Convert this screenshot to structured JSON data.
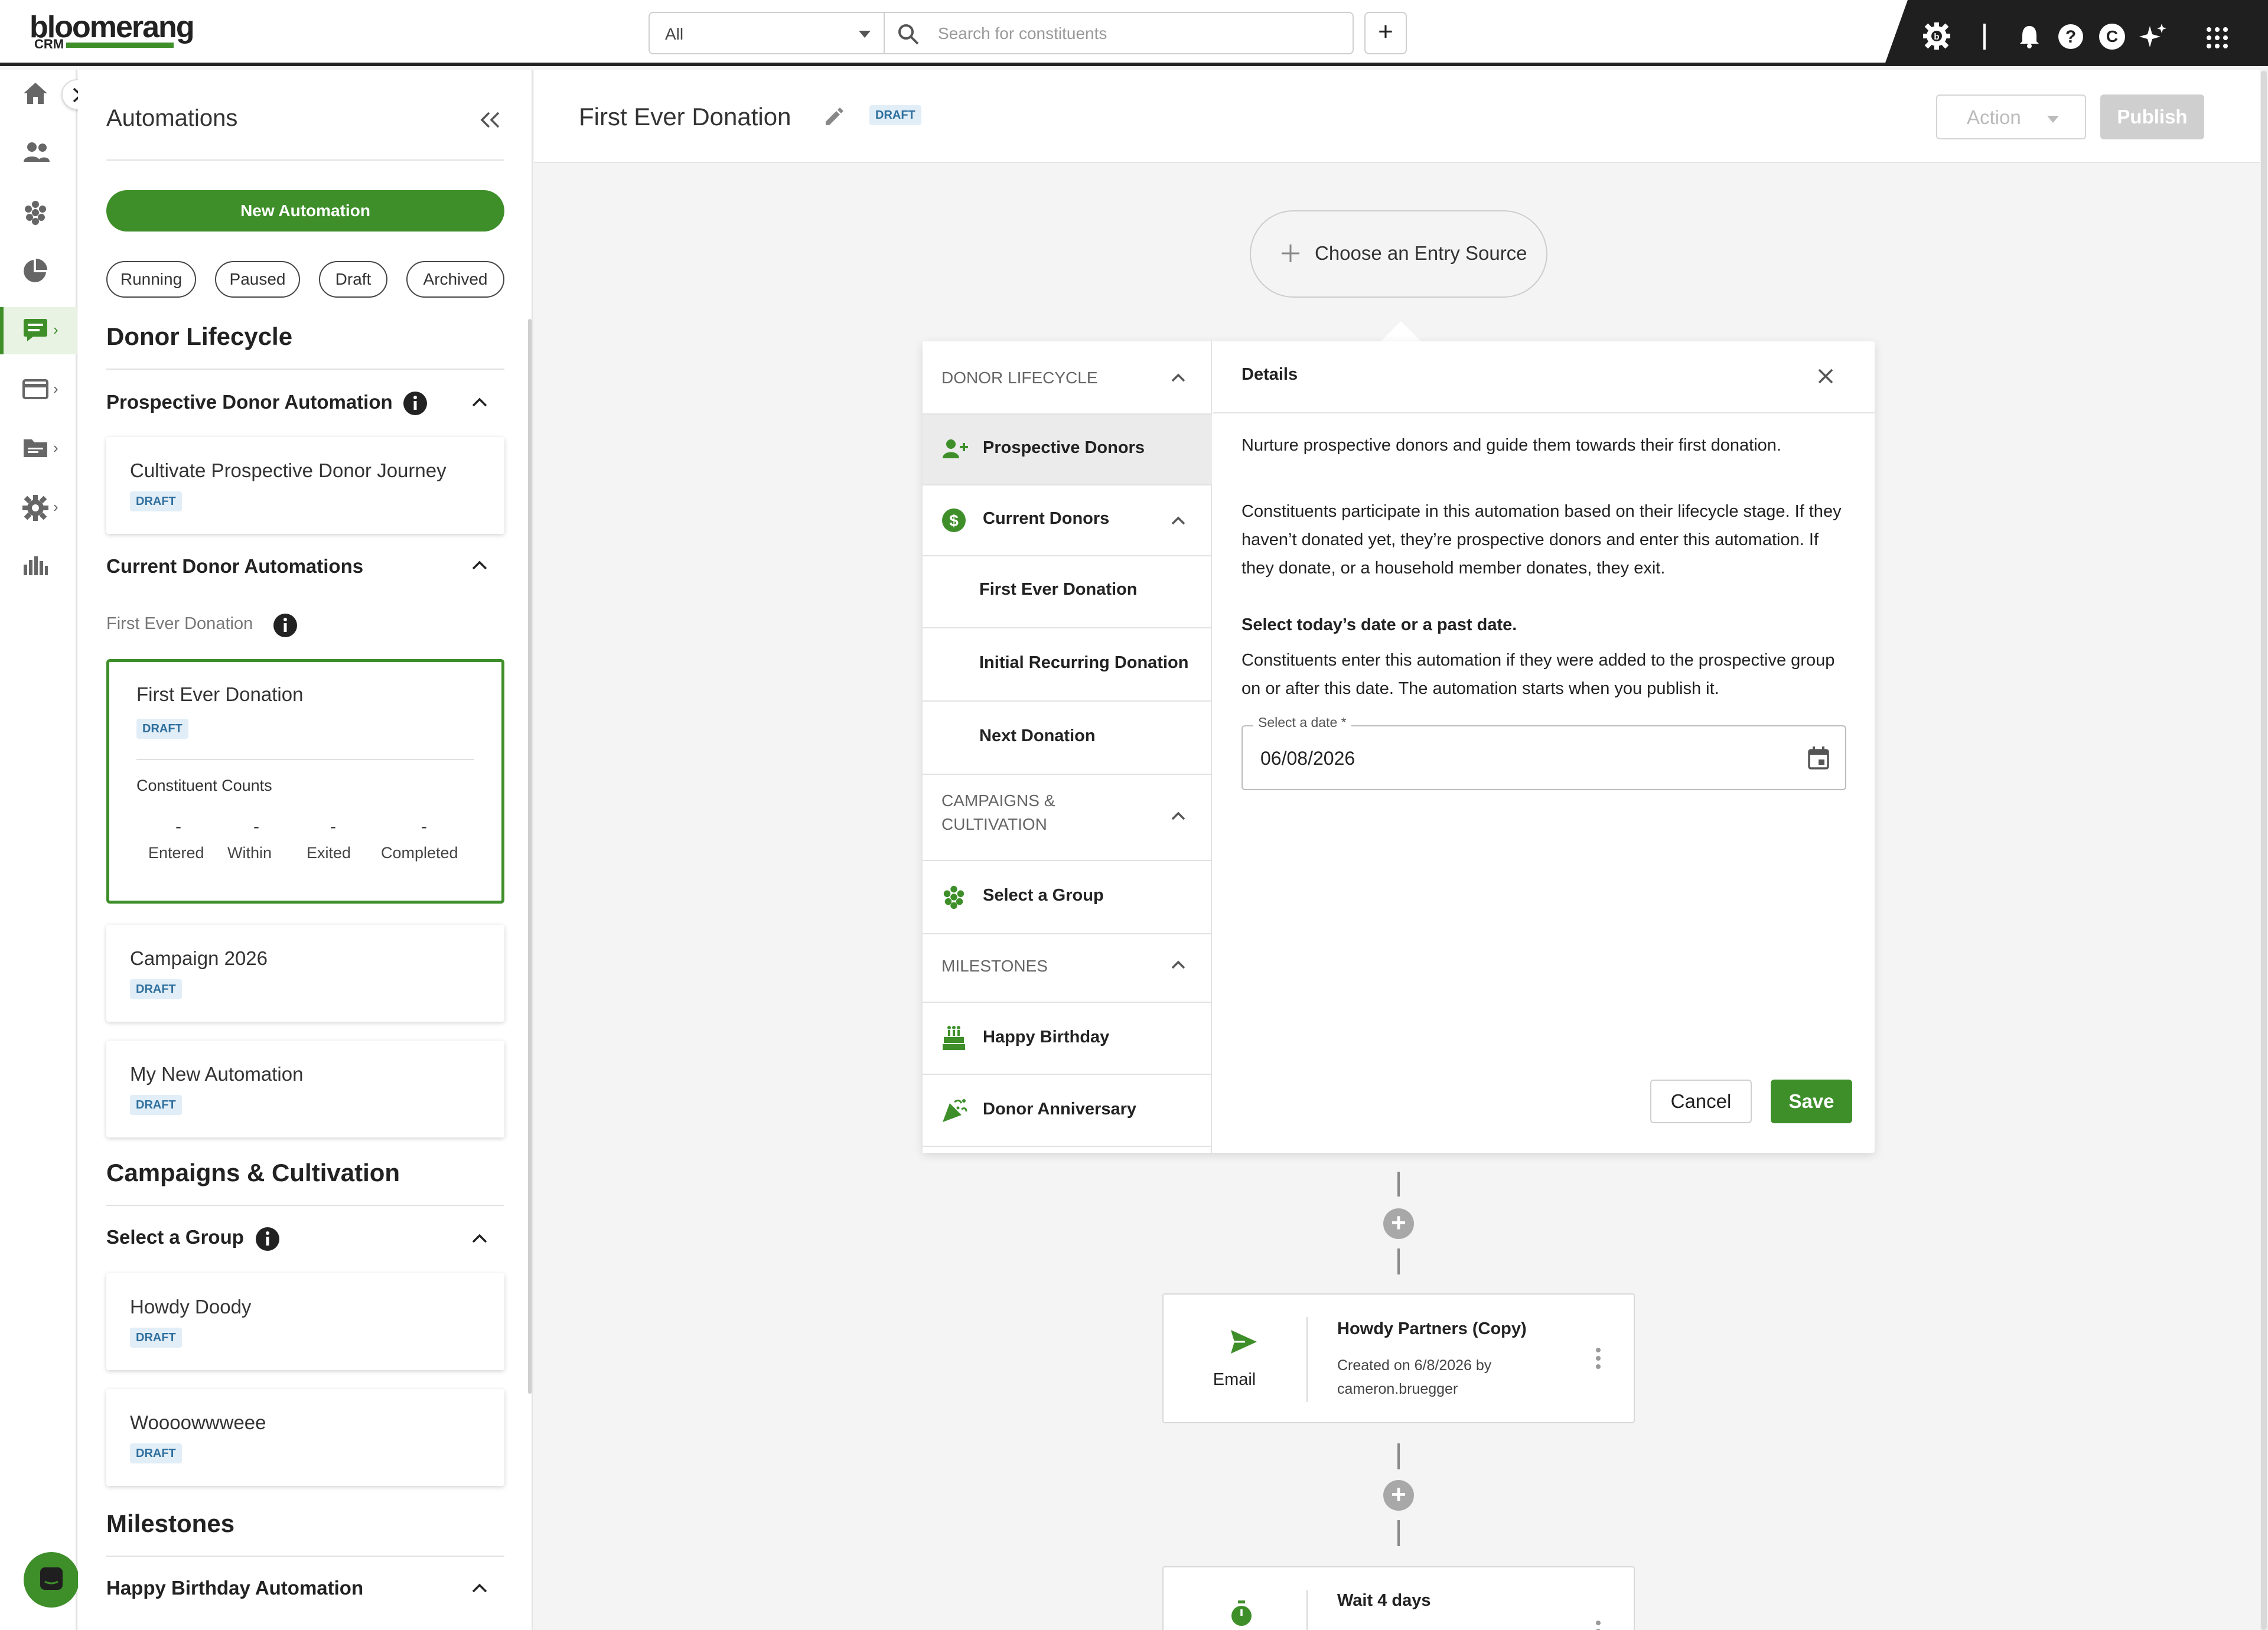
{
  "app": {
    "logo_text": "bloomerang",
    "logo_sub": "CRM",
    "brand_color": "#3e8f2a"
  },
  "topbar": {
    "scope_value": "All",
    "search_placeholder": "Search for constituents",
    "add_label": "+",
    "user_initial": "C",
    "icons": [
      "settings-icon",
      "notification-bell-icon",
      "help-icon",
      "user-avatar",
      "ai-sparkle-icon",
      "app-grid-icon"
    ]
  },
  "rail": {
    "icons": [
      "home-icon",
      "constituents-icon",
      "groups-icon",
      "reports-icon",
      "automations-icon",
      "payments-icon",
      "files-icon",
      "settings-icon",
      "analytics-icon"
    ]
  },
  "list_panel": {
    "title": "Automations",
    "new_button": "New Automation",
    "filters": [
      "Running",
      "Paused",
      "Draft",
      "Archived"
    ],
    "donor_lifecycle": {
      "heading": "Donor Lifecycle",
      "prospective_group": "Prospective Donor Automation",
      "prospective_card": {
        "name": "Cultivate Prospective Donor Journey",
        "status": "DRAFT"
      },
      "current_group": "Current Donor Automations",
      "current_sub": "First Ever Donation",
      "selected_card": {
        "name": "First Ever Donation",
        "status": "DRAFT",
        "counts_label": "Constituent Counts",
        "counts": [
          {
            "value": "-",
            "label": "Entered"
          },
          {
            "value": "-",
            "label": "Within"
          },
          {
            "value": "-",
            "label": "Exited"
          },
          {
            "value": "-",
            "label": "Completed"
          }
        ]
      },
      "other_cards": [
        {
          "name": "Campaign 2026",
          "status": "DRAFT"
        },
        {
          "name": "My New Automation",
          "status": "DRAFT"
        }
      ]
    },
    "campaigns": {
      "heading": "Campaigns & Cultivation",
      "group": "Select a Group",
      "cards": [
        {
          "name": "Howdy Doody",
          "status": "DRAFT"
        },
        {
          "name": "Woooowwweee",
          "status": "DRAFT"
        }
      ]
    },
    "milestones": {
      "heading": "Milestones",
      "group": "Happy Birthday Automation"
    }
  },
  "main": {
    "title": "First Ever Donation",
    "status": "DRAFT",
    "action_label": "Action",
    "publish_label": "Publish",
    "entry_source": "Choose an Entry Source"
  },
  "picker": {
    "categories": {
      "donor_lifecycle": "DONOR LIFECYCLE",
      "campaigns": "CAMPAIGNS & CULTIVATION",
      "milestones": "MILESTONES"
    },
    "rows": {
      "prospective": "Prospective Donors",
      "current": "Current Donors",
      "first_ever": "First Ever Donation",
      "initial_recurring": "Initial Recurring Donation",
      "next_donation": "Next Donation",
      "select_group": "Select a Group",
      "happy_birthday": "Happy Birthday",
      "donor_anniversary": "Donor Anniversary"
    }
  },
  "details": {
    "title": "Details",
    "intro": "Nurture prospective donors and guide them towards their first donation.",
    "body": "Constituents participate in this automation based on their lifecycle stage. If they haven’t donated yet, they’re prospective donors and enter this automation. If they donate, or a household member donates, they exit.",
    "date_heading": "Select today’s date or a past date.",
    "date_body": "Constituents enter this automation if they were added to the prospective group on or after this date. The automation starts when you publish it.",
    "date_label": "Select a date *",
    "date_value": "06/08/2026",
    "cancel": "Cancel",
    "save": "Save"
  },
  "steps": [
    {
      "type": "Email",
      "title": "Howdy Partners (Copy)",
      "meta": "Created on 6/8/2026 by cameron.bruegger"
    },
    {
      "type": "Wait",
      "title": "Wait 4 days"
    }
  ]
}
